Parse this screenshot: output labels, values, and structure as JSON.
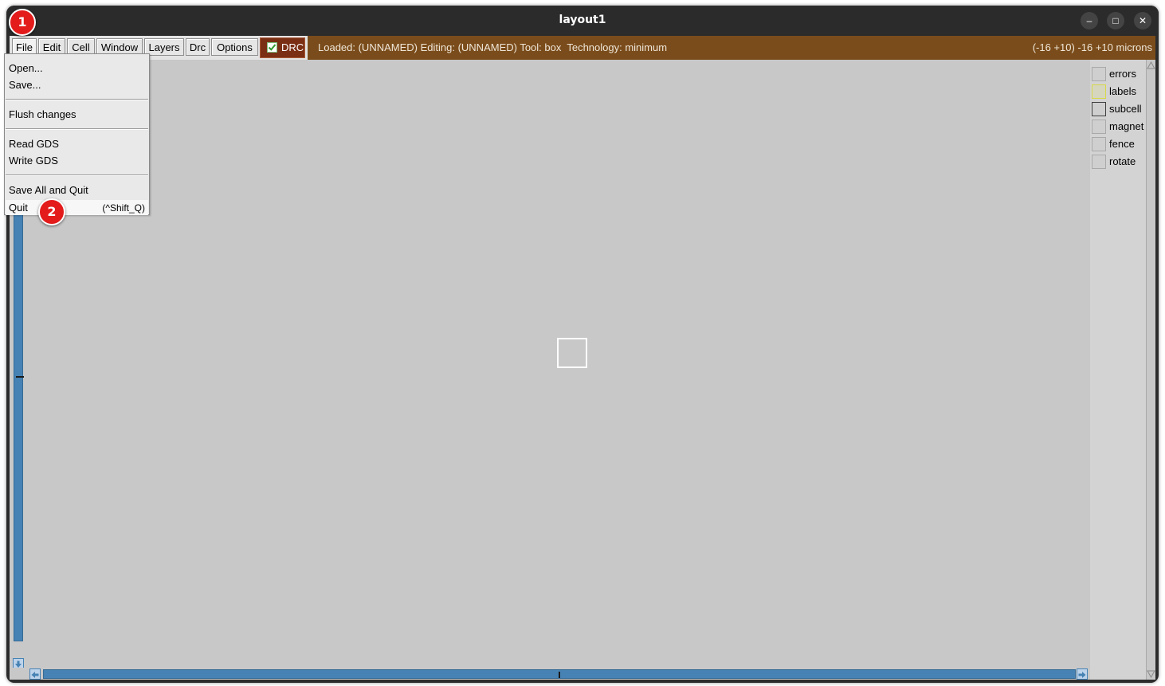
{
  "window": {
    "title": "layout1",
    "controls": {
      "minimize": "–",
      "maximize": "□",
      "close": "✕"
    }
  },
  "menubar": {
    "items": [
      {
        "id": "file",
        "label": "File"
      },
      {
        "id": "edit",
        "label": "Edit"
      },
      {
        "id": "cell",
        "label": "Cell"
      },
      {
        "id": "window",
        "label": "Window"
      },
      {
        "id": "layers",
        "label": "Layers"
      },
      {
        "id": "drc",
        "label": "Drc"
      },
      {
        "id": "options",
        "label": "Options"
      }
    ],
    "drc_toggle": {
      "label": "DRC",
      "checked": true
    }
  },
  "status": {
    "left": "Loaded: (UNNAMED) Editing: (UNNAMED) Tool: box  Technology: minimum",
    "right": "(-16 +10) -16 +10 microns"
  },
  "file_menu": {
    "items": [
      {
        "label": "Open..."
      },
      {
        "label": "Save..."
      },
      {
        "label": "Flush changes"
      },
      {
        "label": "Read GDS"
      },
      {
        "label": "Write GDS"
      },
      {
        "label": "Save All and Quit"
      },
      {
        "label": "Quit",
        "shortcut": "(^Shift_Q)"
      }
    ]
  },
  "layers": [
    {
      "name": "errors",
      "swatch_color": "#cfcfcf",
      "border_color": "#a9a9a9"
    },
    {
      "name": "labels",
      "swatch_color": "#d6d6bf",
      "border_color": "#d8d84a"
    },
    {
      "name": "subcell",
      "swatch_color": "#cfcfcf",
      "border_color": "#404040"
    },
    {
      "name": "magnet",
      "swatch_color": "#cfcfcf",
      "border_color": "#a9a9a9"
    },
    {
      "name": "fence",
      "swatch_color": "#cfcfcf",
      "border_color": "#a9a9a9"
    },
    {
      "name": "rotate",
      "swatch_color": "#cfcfcf",
      "border_color": "#a9a9a9"
    }
  ],
  "markers": {
    "first": "1",
    "second": "2"
  },
  "colors": {
    "status_bar": "#7a4c1b",
    "drc_button": "#7a2f14",
    "scrollbar": "#4682b4",
    "canvas": "#c8c8c8",
    "marker": "#e31b1b"
  }
}
